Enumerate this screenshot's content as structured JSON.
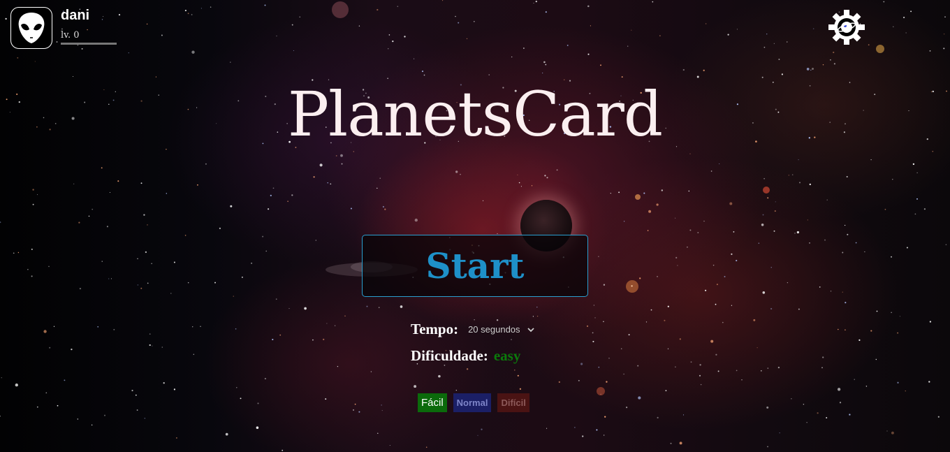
{
  "profile": {
    "avatar_icon": "alien-head-icon",
    "username": "dani",
    "level": "lv. 0",
    "xp_progress": 0
  },
  "settings": {
    "icon": "gear-planet-icon"
  },
  "title": "PlanetsCard",
  "start": {
    "label": "Start"
  },
  "options": {
    "tempo_label": "Tempo:",
    "tempo_value": "20 segundos",
    "dificuldade_label": "Dificuldade:",
    "dificuldade_value": "easy"
  },
  "difficulty_buttons": {
    "facil": "Fácil",
    "normal": "Normal",
    "dificil": "Difícil"
  },
  "colors": {
    "start_accent": "#1e90c8",
    "easy_green": "#0b7a0b",
    "normal_blue": "#1b1f66",
    "hard_red": "#4a1313"
  }
}
